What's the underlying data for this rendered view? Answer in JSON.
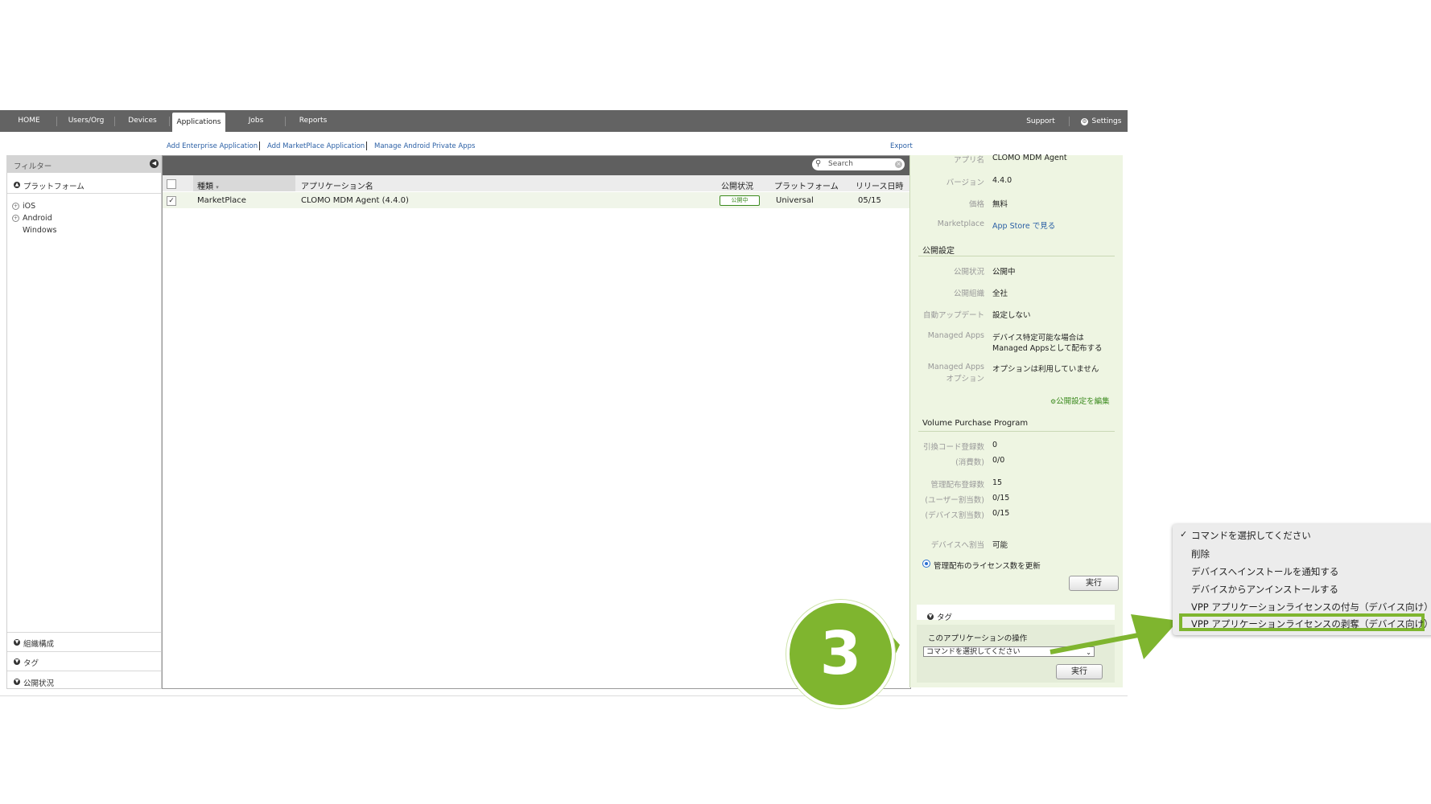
{
  "nav": {
    "items": [
      {
        "label": "HOME"
      },
      {
        "label": "Users/Org"
      },
      {
        "label": "Devices"
      },
      {
        "label": "Applications"
      },
      {
        "label": "Jobs"
      },
      {
        "label": "Reports"
      }
    ],
    "support": "Support",
    "settings": "Settings"
  },
  "links": {
    "add_enterprise": "Add Enterprise Application",
    "add_marketplace": "Add MarketPlace Application",
    "manage_android": "Manage Android Private Apps",
    "export": "Export"
  },
  "filter": {
    "title": "フィルター",
    "platform_section": "プラットフォーム",
    "platforms": [
      "iOS",
      "Android",
      "Windows"
    ],
    "org_section": "組織構成",
    "tag_section": "タグ",
    "status_section": "公開状況"
  },
  "list": {
    "search_placeholder": "Search",
    "columns": [
      "種類",
      "アプリケーション名",
      "公開状況",
      "プラットフォーム",
      "リリース日時"
    ],
    "rows": [
      {
        "type": "MarketPlace",
        "name": "CLOMO MDM Agent (4.4.0)",
        "status": "公開中",
        "platform": "Universal",
        "release": "05/15"
      }
    ]
  },
  "detail": {
    "app_name_label": "アプリ名",
    "app_name": "CLOMO MDM Agent",
    "version_label": "バージョン",
    "version": "4.4.0",
    "price_label": "価格",
    "price": "無料",
    "marketplace_label": "Marketplace",
    "marketplace_link": "App Store で見る",
    "publish_section": "公開設定",
    "pub_status_label": "公開状況",
    "pub_status": "公開中",
    "pub_org_label": "公開組織",
    "pub_org": "全社",
    "auto_update_label": "自動アップデート",
    "auto_update": "設定しない",
    "managed_apps_label": "Managed Apps",
    "managed_apps_line1": "デバイス特定可能な場合は",
    "managed_apps_line2": "Managed Appsとして配布する",
    "managed_opt_label1": "Managed Apps",
    "managed_opt_label2": "オプション",
    "managed_opt": "オプションは利用していません",
    "edit_publish": "公開設定を編集",
    "vpp_section": "Volume Purchase Program",
    "redeem_label": "引換コード登録数",
    "redeem": "0",
    "consumed_label": "(消費数)",
    "consumed": "0/0",
    "managed_dist_label": "管理配布登録数",
    "managed_dist": "15",
    "user_assign_label": "(ユーザー割当数)",
    "user_assign": "0/15",
    "device_assign_label": "(デバイス割当数)",
    "device_assign": "0/15",
    "device_assignable_label": "デバイスへ割当",
    "device_assignable": "可能",
    "update_license_radio": "管理配布のライセンス数を更新",
    "run_button": "実行",
    "tag_section": "タグ",
    "ops_title": "このアプリケーションの操作",
    "select_value": "コマンドを選択してください",
    "run_button2": "実行"
  },
  "callout": {
    "number": "3"
  },
  "dropdown": {
    "options": [
      "コマンドを選択してください",
      "削除",
      "デバイスへインストールを通知する",
      "デバイスからアンインストールする",
      "VPP アプリケーションライセンスの付与（デバイス向け）",
      "VPP アプリケーションライセンスの剥奪（デバイス向け）"
    ]
  },
  "colors": {
    "accent_green": "#7fb52f",
    "nav_bg": "#636363",
    "link_blue": "#2a5fa5"
  }
}
